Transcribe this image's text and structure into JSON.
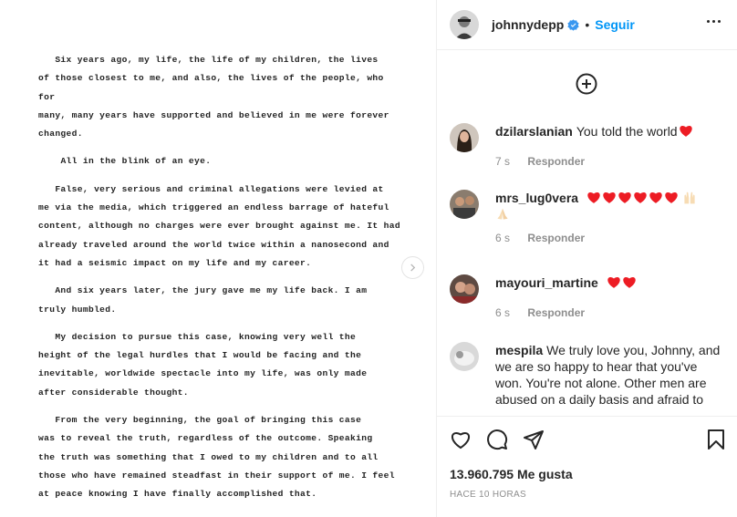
{
  "letter": {
    "paragraphs": [
      "   Six years ago, my life, the life of my children, the lives\nof those closest to me, and also, the lives of the people, who for\nmany, many years have supported and believed in me were forever\nchanged.",
      "    All in the blink of an eye.",
      "   False, very serious and criminal allegations were levied at\nme via the media, which triggered an endless barrage of hateful\ncontent, although no charges were ever brought against me. It had\nalready traveled around the world twice within a nanosecond and\nit had a seismic impact on my life and my career.",
      "   And six years later, the jury gave me my life back. I am\ntruly humbled.",
      "   My decision to pursue this case, knowing very well the\nheight of the legal hurdles that I would be facing and the\ninevitable, worldwide spectacle into my life, was only made\nafter considerable thought.",
      "   From the very beginning, the goal of bringing this case\nwas to reveal the truth, regardless of the outcome. Speaking\nthe truth was something that I owed to my children and to all\nthose who have remained steadfast in their support of me. I feel\nat peace knowing I have finally accomplished that."
    ]
  },
  "header": {
    "username": "johnnydepp",
    "separator": "•",
    "follow_label": "Seguir"
  },
  "comments": [
    {
      "username": "dzilarslanian",
      "text": "You told the world",
      "hearts": 1,
      "time": "7 s",
      "reply": "Responder"
    },
    {
      "username": "mrs_lug0vera",
      "text": "",
      "hearts": 6,
      "time": "6 s",
      "reply": "Responder"
    },
    {
      "username": "mayouri_martine",
      "text": "",
      "hearts": 2,
      "time": "6 s",
      "reply": "Responder"
    },
    {
      "username": "mespila",
      "text": "We truly love you, Johnny, and we are so happy to hear that you've won. You're not alone. Other men are abused on a daily basis and afraid to"
    }
  ],
  "likes": {
    "label": "13.960.795 Me gusta"
  },
  "timestamp": "Hace 10 horas",
  "colors": {
    "accent": "#0095f6",
    "heart": "#ed1c24",
    "text": "#262626",
    "muted": "#8e8e8e"
  },
  "icons": [
    "chevron-right-icon",
    "verified-badge-icon",
    "more-options-icon",
    "add-comment-icon",
    "heart-icon",
    "comment-icon",
    "share-icon",
    "save-icon"
  ]
}
